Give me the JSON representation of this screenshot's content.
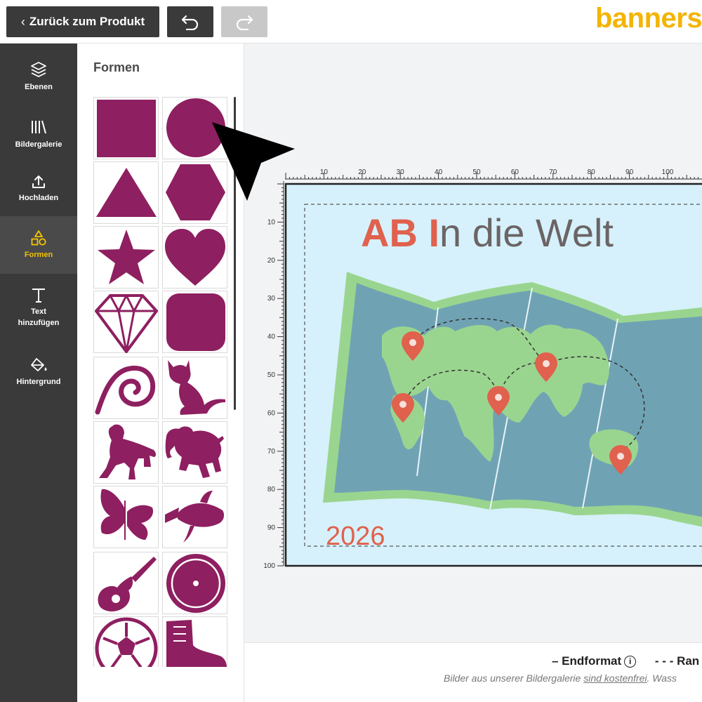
{
  "toolbar": {
    "back_label": "Zurück zum Produkt",
    "undo_icon": "undo-icon",
    "redo_icon": "redo-icon",
    "logo_text": "bannerst"
  },
  "nav": {
    "items": [
      {
        "label": "Ebenen",
        "icon": "layers-icon"
      },
      {
        "label": "Bildergalerie",
        "icon": "library-icon"
      },
      {
        "label": "Hochladen",
        "icon": "upload-icon"
      },
      {
        "label": "Formen",
        "icon": "shapes-icon",
        "active": true
      },
      {
        "label": "Text hinzufügen",
        "icon": "text-icon"
      },
      {
        "label": "Hintergrund",
        "icon": "paint-bucket-icon"
      }
    ]
  },
  "panel": {
    "title": "Formen",
    "shape_color": "#8e1f60",
    "shapes": [
      "square",
      "circle",
      "triangle",
      "hexagon",
      "star",
      "heart",
      "diamond",
      "rounded-square",
      "spiral",
      "cat",
      "dog",
      "elephant",
      "butterfly",
      "fish",
      "guitar",
      "record",
      "football",
      "boot"
    ]
  },
  "ruler": {
    "top_ticks": [
      "10",
      "20",
      "30",
      "40",
      "50",
      "60",
      "70",
      "80",
      "90",
      "100"
    ],
    "left_ticks": [
      "10",
      "20",
      "30",
      "40",
      "50",
      "60",
      "70",
      "80",
      "90",
      "100"
    ]
  },
  "design": {
    "title_accent": "AB I",
    "title_rest": "n die Welt",
    "year": "2026",
    "accent_color": "#e0614d",
    "title_color": "#6b6464",
    "background_color": "#d6f1fb",
    "map_border_color": "#9ad58f",
    "map_water_color": "#6fa3b4",
    "land_color": "#9ad58f"
  },
  "footer": {
    "legend_final": "– Endformat",
    "legend_edge": "- - - Ran",
    "note_text": "Bilder aus unserer Bildergalerie ",
    "note_link": "sind kostenfrei",
    "note_tail": ". Wass"
  }
}
